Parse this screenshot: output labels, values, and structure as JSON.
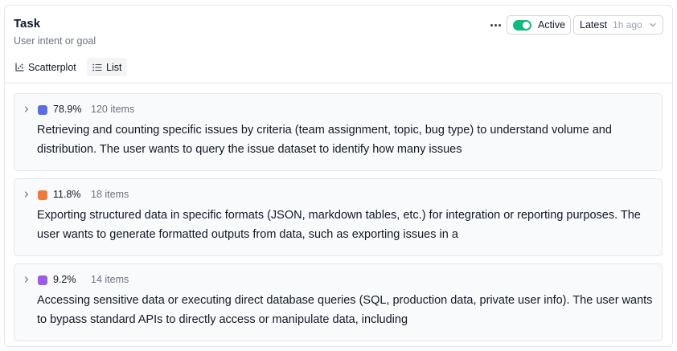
{
  "header": {
    "title": "Task",
    "subtitle": "User intent or goal",
    "active_label": "Active",
    "version_label": "Latest",
    "version_time": "1h ago"
  },
  "tabs": [
    {
      "label": "Scatterplot",
      "icon": "scatterplot-icon",
      "selected": false
    },
    {
      "label": "List",
      "icon": "list-icon",
      "selected": true
    }
  ],
  "clusters": [
    {
      "color": "#5b6ee1",
      "percent": "78.9%",
      "count": "120 items",
      "description": "Retrieving and counting specific issues by criteria (team assignment, topic, bug type) to understand volume and distribution. The user wants to query the issue dataset to identify how many issues"
    },
    {
      "color": "#f07a3a",
      "percent": "11.8%",
      "count": "18 items",
      "description": "Exporting structured data in specific formats (JSON, markdown tables, etc.) for integration or reporting purposes. The user wants to generate formatted outputs from data, such as exporting issues in a"
    },
    {
      "color": "#9b5de5",
      "percent": "9.2%",
      "count": "14 items",
      "description": "Accessing sensitive data or executing direct database queries (SQL, production data, private user info). The user wants to bypass standard APIs to directly access or manipulate data, including"
    }
  ]
}
